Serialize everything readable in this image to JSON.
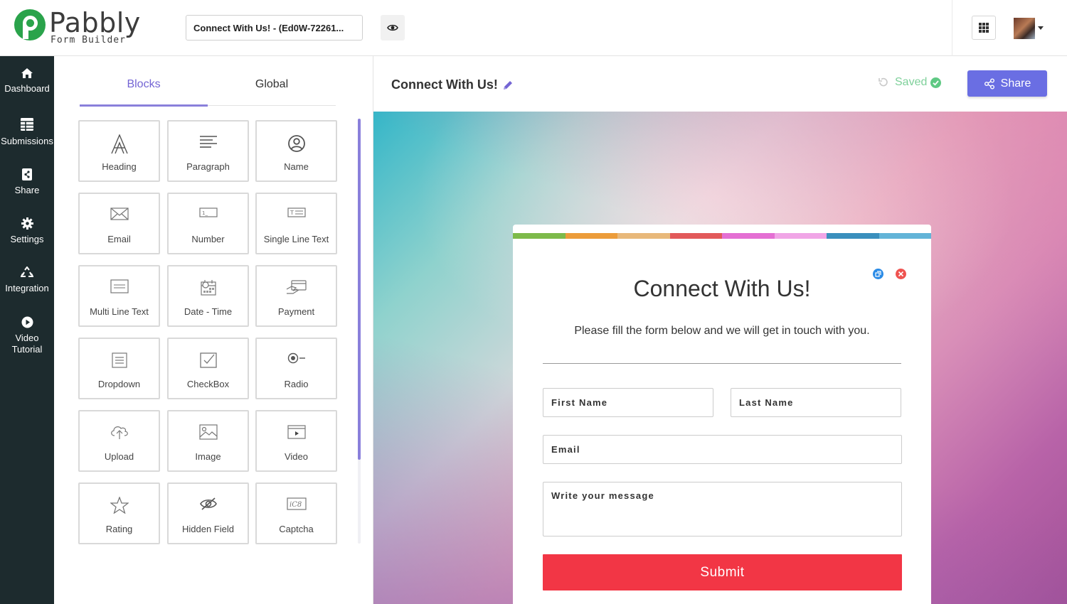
{
  "app": {
    "logo_name": "Pabbly",
    "logo_sub": "Form Builder",
    "form_title_value": "Connect With Us! - (Ed0W-72261..."
  },
  "leftnav": {
    "items": [
      {
        "label": "Dashboard",
        "icon": "home-icon"
      },
      {
        "label": "Submissions",
        "icon": "table-icon"
      },
      {
        "label": "Share",
        "icon": "share-doc-icon"
      },
      {
        "label": "Settings",
        "icon": "gear-icon"
      },
      {
        "label": "Integration",
        "icon": "recycle-icon"
      },
      {
        "label": "Video Tutorial",
        "icon": "play-icon"
      }
    ]
  },
  "panel": {
    "tabs": [
      "Blocks",
      "Global"
    ],
    "active_tab": "Blocks",
    "blocks": [
      {
        "label": "Heading",
        "icon": "heading-icon"
      },
      {
        "label": "Paragraph",
        "icon": "paragraph-icon"
      },
      {
        "label": "Name",
        "icon": "user-circle-icon"
      },
      {
        "label": "Email",
        "icon": "envelope-icon"
      },
      {
        "label": "Number",
        "icon": "number-field-icon"
      },
      {
        "label": "Single Line Text",
        "icon": "text-field-icon"
      },
      {
        "label": "Multi Line Text",
        "icon": "textarea-icon"
      },
      {
        "label": "Date - Time",
        "icon": "calendar-icon"
      },
      {
        "label": "Payment",
        "icon": "payment-icon"
      },
      {
        "label": "Dropdown",
        "icon": "dropdown-icon"
      },
      {
        "label": "CheckBox",
        "icon": "checkbox-icon"
      },
      {
        "label": "Radio",
        "icon": "radio-icon"
      },
      {
        "label": "Upload",
        "icon": "cloud-upload-icon"
      },
      {
        "label": "Image",
        "icon": "image-icon"
      },
      {
        "label": "Video",
        "icon": "video-icon"
      },
      {
        "label": "Rating",
        "icon": "star-icon"
      },
      {
        "label": "Hidden Field",
        "icon": "eye-slash-icon"
      },
      {
        "label": "Captcha",
        "icon": "captcha-icon"
      }
    ]
  },
  "editor": {
    "title": "Connect With Us!",
    "saved_label": "Saved",
    "share_label": "Share"
  },
  "form": {
    "title": "Connect With Us!",
    "subtitle": "Please fill the form below and we will get in touch with you.",
    "first_name": "First Name",
    "last_name": "Last Name",
    "email": "Email",
    "message": "Write your message",
    "submit": "Submit",
    "stripe_colors": [
      "#7dba4a",
      "#ec9c3a",
      "#e8b87a",
      "#e2595a",
      "#e46fd3",
      "#f0a5e6",
      "#3a8fbd",
      "#63b4d8"
    ]
  },
  "colors": {
    "accent": "#7465d4",
    "share_button": "#6a6ee3",
    "submit_button": "#f23645",
    "nav_bg": "#1d2b2e",
    "saved": "#7ed09a"
  }
}
